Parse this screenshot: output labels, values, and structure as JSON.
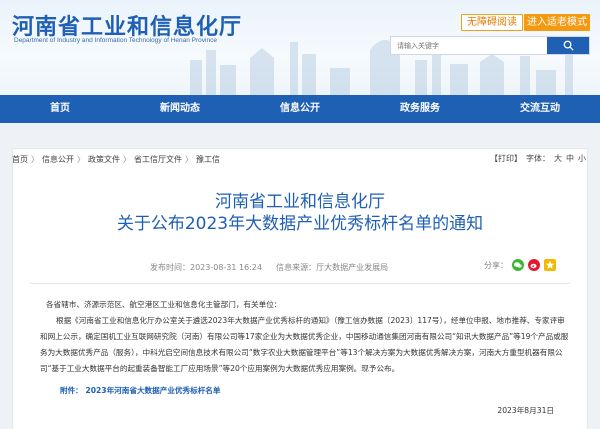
{
  "header": {
    "title": "河南省工业和信息化厅",
    "subtitle": "Department of Industry and Information Technology of Henan Province",
    "barrier_free": "无障碍阅读",
    "elder_mode": "进入适老模式",
    "search_placeholder": "请输入关键字"
  },
  "nav": {
    "items": [
      "首页",
      "新闻动态",
      "信息公开",
      "政务服务",
      "交流互动"
    ]
  },
  "breadcrumb": [
    "首页",
    "信息公开",
    "政策文件",
    "省工信厅文件",
    "豫工信"
  ],
  "tools": {
    "print": "【打印】",
    "font_label": "字体：",
    "large": "大",
    "medium": "中",
    "small": "小"
  },
  "article": {
    "title_line1": "河南省工业和信息化厅",
    "title_line2": "关于公布2023年大数据产业优秀标杆名单的通知",
    "published": "发布时间：2023-08-31 16:24",
    "source": "信息来源：厅大数据产业发展局",
    "share_label": "分享：",
    "salutation": "各省辖市、济源示范区、航空港区工业和信息化主管部门，有关单位：",
    "paragraph": "根据《河南省工业和信息化厅办公室关于遴选2023年大数据产业优秀标杆的通知》（豫工信办数据〔2023〕117号），经单位申报、地市推荐、专家评审和网上公示，确定国机工业互联网研究院（河南）有限公司等17家企业为大数据优秀企业，中国移动通信集团河南有限公司“知讯大数据产品”等19个产品或服务为大数据优秀产品（服务），中科光启空间信息技术有限公司“数字农业大数据管理平台”等13个解决方案为大数据优秀解决方案，河南大方重型机器有限公司“基于工业大数据平台的起重装备智能工厂应用场景”等20个应用案例为大数据优秀应用案例。现予公布。",
    "attachment_label": "附件：",
    "attachment_link": "2023年河南省大数据产业优秀标杆名单",
    "date": "2023年8月31日"
  },
  "colors": {
    "brand_blue": "#1e60b3",
    "accent_orange": "#f39a12"
  }
}
